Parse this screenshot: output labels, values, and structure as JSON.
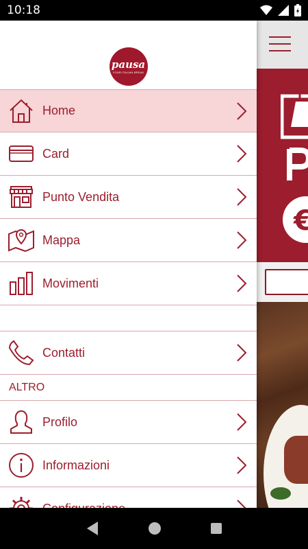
{
  "status_bar": {
    "time": "10:18"
  },
  "logo": {
    "brand": "pausa",
    "tagline": "YOUR ITALIAN BREAK"
  },
  "menu": {
    "items": [
      {
        "label": "Home",
        "icon": "home-icon"
      },
      {
        "label": "Card",
        "icon": "card-icon"
      },
      {
        "label": "Punto Vendita",
        "icon": "store-icon"
      },
      {
        "label": "Mappa",
        "icon": "map-icon"
      },
      {
        "label": "Movimenti",
        "icon": "bar-chart-icon"
      }
    ],
    "contacts": {
      "label": "Contatti",
      "icon": "phone-icon"
    },
    "section_title": "ALTRO",
    "other_items": [
      {
        "label": "Profilo",
        "icon": "user-icon"
      },
      {
        "label": "Informazioni",
        "icon": "info-icon"
      },
      {
        "label": "Configurazione",
        "icon": "gear-icon"
      }
    ]
  },
  "colors": {
    "accent": "#9c1d2d",
    "active_bg": "#f8d5d7",
    "divider": "#d9a7ad"
  }
}
